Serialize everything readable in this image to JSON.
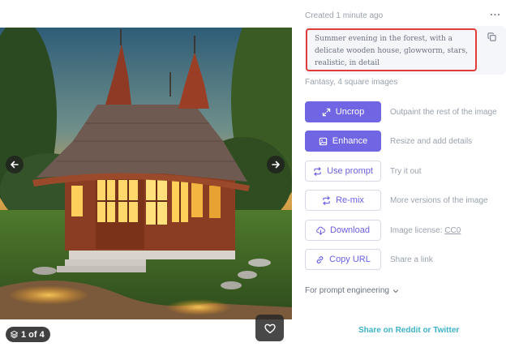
{
  "image": {
    "counter": "1 of 4",
    "icons": {
      "prev": "arrow-left-icon",
      "next": "arrow-right-icon",
      "layers": "layers-icon",
      "like": "heart-icon"
    }
  },
  "panel": {
    "created": "Created 1 minute ago",
    "more_icon": "ellipsis-icon",
    "prompt_lines": [
      "Summer evening in the forest, with a",
      "delicate wooden house, glowworm, stars,",
      "realistic, in detail"
    ],
    "style_info": "Fantasy, 4 square images",
    "actions": [
      {
        "label": "Uncrop",
        "desc": "Outpaint the rest of the image",
        "icon": "expand-icon",
        "style": "primary"
      },
      {
        "label": "Enhance",
        "desc": "Resize and add details",
        "icon": "image-icon",
        "style": "primary"
      },
      {
        "label": "Use prompt",
        "desc": "Try it out",
        "icon": "repeat-icon",
        "style": "secondary"
      },
      {
        "label": "Re-mix",
        "desc": "More versions of the image",
        "icon": "repeat-icon",
        "style": "secondary"
      },
      {
        "label": "Download",
        "desc": "Image license:",
        "link": "CC0",
        "icon": "cloud-download-icon",
        "style": "secondary"
      },
      {
        "label": "Copy URL",
        "desc": "Share a link",
        "icon": "link-icon",
        "style": "secondary"
      }
    ],
    "engineering": "For prompt engineering",
    "share": "Share on Reddit or Twitter"
  },
  "colors": {
    "accent": "#7065e3",
    "highlight_border": "#e23b3b",
    "share_link": "#3fb2c9"
  }
}
